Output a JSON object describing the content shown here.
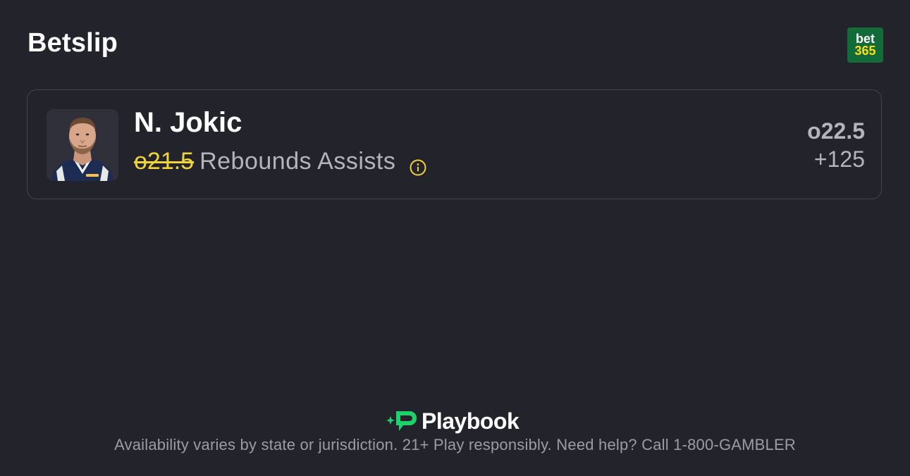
{
  "header": {
    "title": "Betslip",
    "book_logo": {
      "line1": "bet",
      "line2": "365",
      "bg_color": "#146b3a",
      "accent_color": "#ffdf1b"
    }
  },
  "bet": {
    "player_name": "N. Jokic",
    "old_line": "o21.5",
    "market": "Rebounds Assists",
    "new_line": "o22.5",
    "odds": "+125",
    "info_icon": "info-circle-icon",
    "old_line_color": "#f1d33a"
  },
  "footer": {
    "brand": "Playbook",
    "brand_accent": "#1fd16b",
    "disclaimer": "Availability varies by state or jurisdiction. 21+ Play responsibly. Need help? Call 1-800-GAMBLER"
  }
}
